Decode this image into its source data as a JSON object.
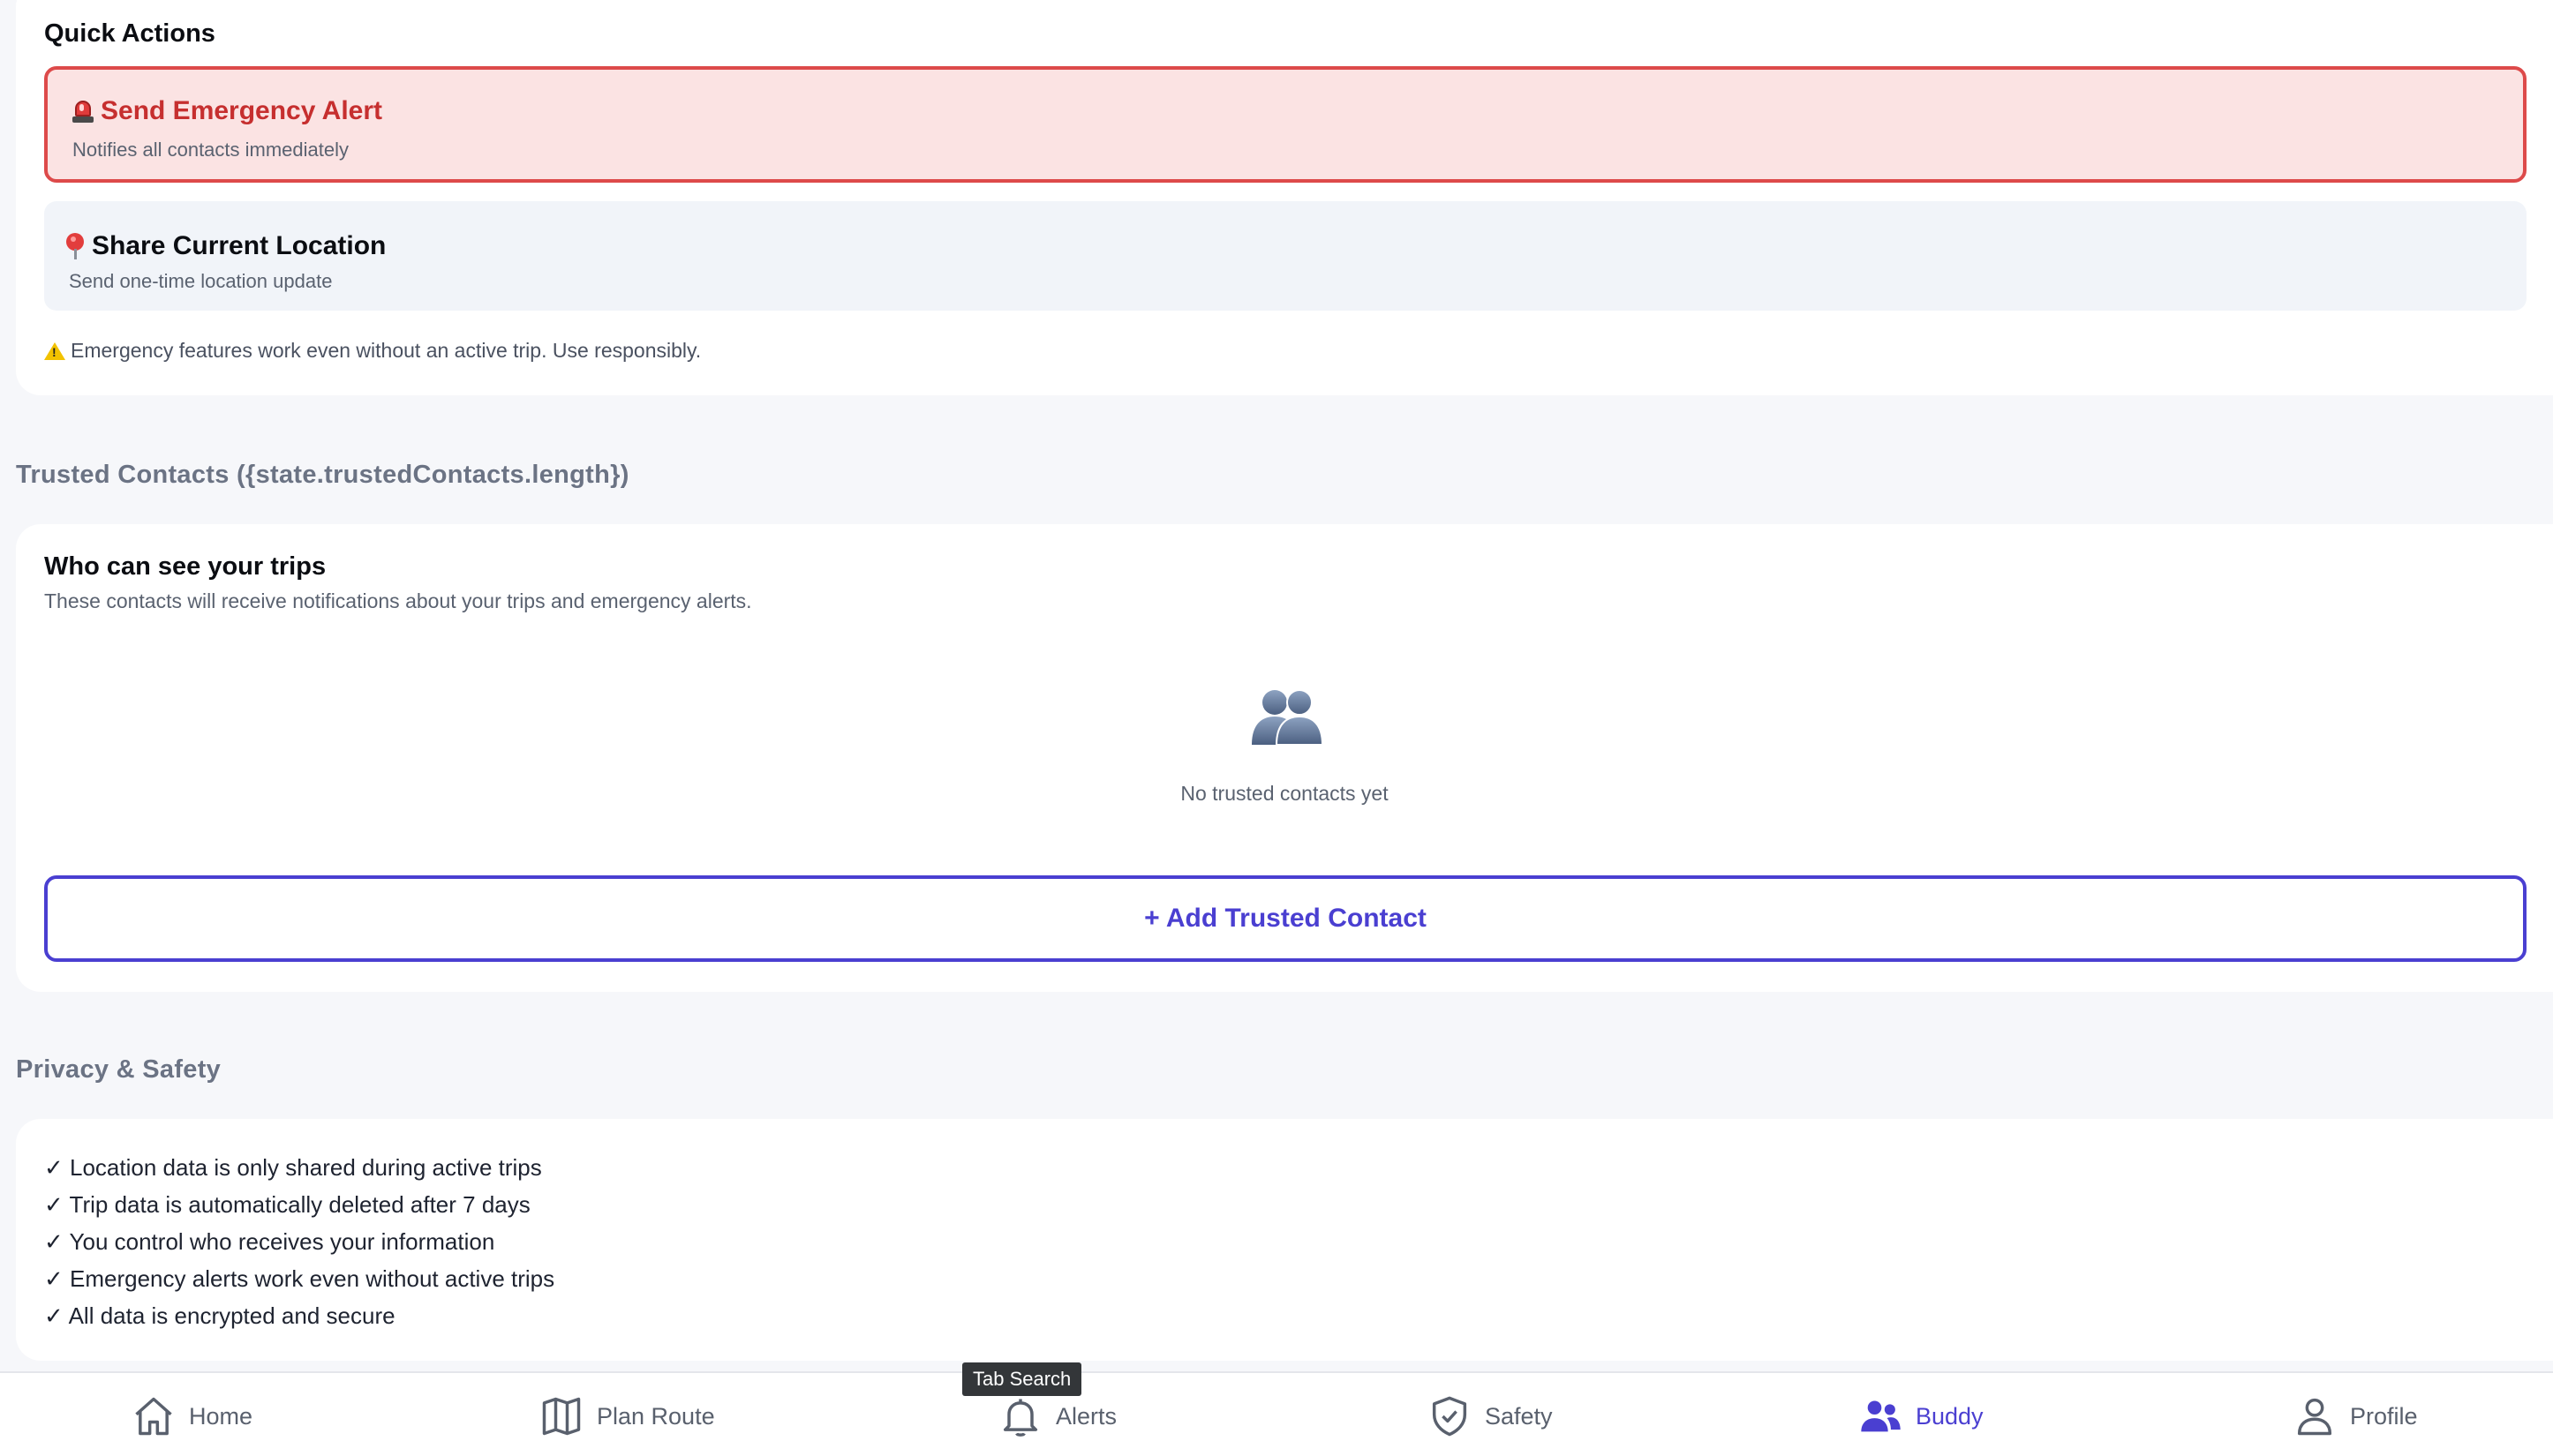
{
  "quick_actions": {
    "title": "Quick Actions",
    "emergency": {
      "label": "Send Emergency Alert",
      "sub": "Notifies all contacts immediately",
      "icon": "siren-icon",
      "color": "#c62f2f"
    },
    "share": {
      "label": "Share Current Location",
      "sub": "Send one-time location update",
      "icon": "pin-icon"
    },
    "note": "Emergency features work even without an active trip. Use responsibly."
  },
  "contacts": {
    "header": "Trusted Contacts ({state.trustedContacts.length})",
    "title": "Who can see your trips",
    "description": "These contacts will receive notifications about your trips and emergency alerts.",
    "empty_icon": "people-icon",
    "empty_text": "No trusted contacts yet",
    "add_button": "+ Add Trusted Contact"
  },
  "privacy": {
    "header": "Privacy & Safety",
    "items": [
      "✓ Location data is only shared during active trips",
      "✓ Trip data is automatically deleted after 7 days",
      "✓ You control who receives your information",
      "✓ Emergency alerts work even without active trips",
      "✓ All data is encrypted and secure"
    ]
  },
  "nav": {
    "items": [
      {
        "label": "Home",
        "icon": "home-icon"
      },
      {
        "label": "Plan Route",
        "icon": "map-icon"
      },
      {
        "label": "Alerts",
        "icon": "bell-icon"
      },
      {
        "label": "Safety",
        "icon": "shield-check-icon"
      },
      {
        "label": "Buddy",
        "icon": "users-icon"
      },
      {
        "label": "Profile",
        "icon": "user-icon"
      }
    ],
    "active": "Buddy",
    "active_color": "#4a3fd1"
  },
  "tooltip": "Tab Search"
}
